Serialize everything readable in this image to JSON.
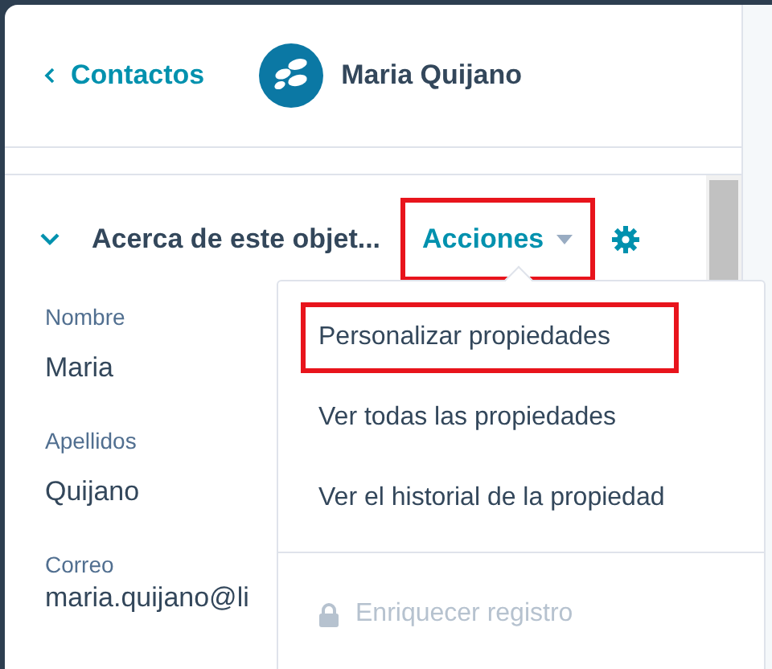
{
  "header": {
    "back_link": "Contactos",
    "contact_name": "Maria Quijano"
  },
  "section": {
    "title": "Acerca de este objet...",
    "expanded": true,
    "actions_button": {
      "label": "Acciones",
      "highlighted": true
    }
  },
  "fields": [
    {
      "label": "Nombre",
      "value": "Maria"
    },
    {
      "label": "Apellidos",
      "value": "Quijano"
    },
    {
      "label": "Correo",
      "value": "maria.quijano@li"
    }
  ],
  "actions_menu": {
    "open": true,
    "items": [
      {
        "kind": "action",
        "label": "Personalizar propiedades",
        "disabled": false,
        "highlighted": true
      },
      {
        "kind": "action",
        "label": "Ver todas las propiedades",
        "disabled": false,
        "highlighted": false
      },
      {
        "kind": "action",
        "label": "Ver el historial de la propiedad",
        "disabled": false,
        "highlighted": false
      },
      {
        "kind": "divider"
      },
      {
        "kind": "locked",
        "label": "Enriquecer registro",
        "disabled": true,
        "highlighted": false
      }
    ]
  }
}
